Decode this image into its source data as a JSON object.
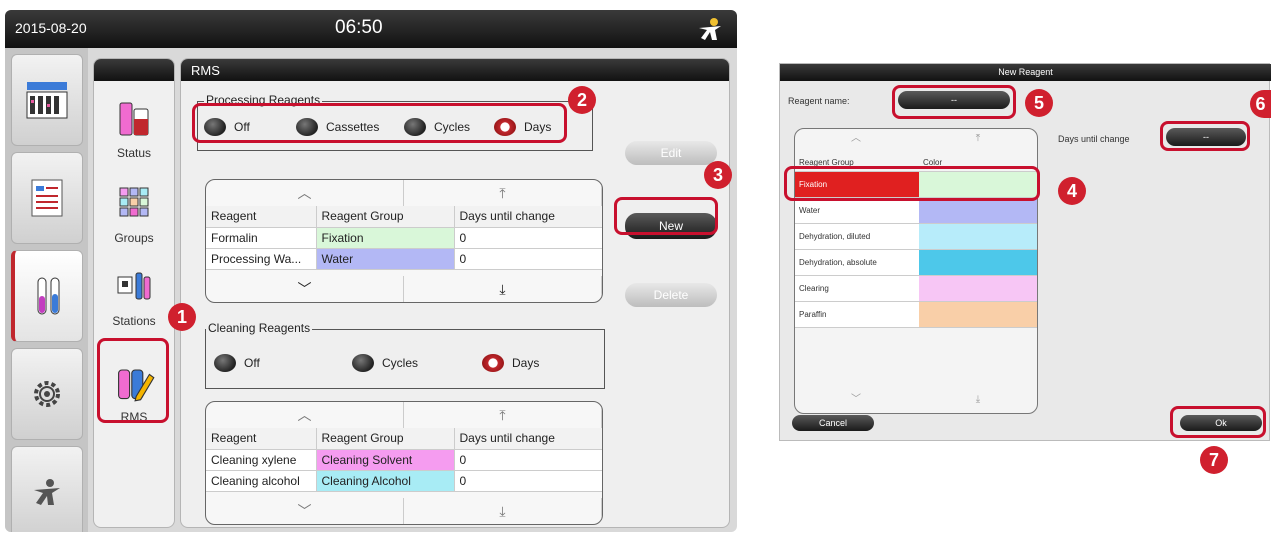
{
  "topbar": {
    "date": "2015-08-20",
    "time": "06:50"
  },
  "subnav": {
    "status": "Status",
    "groups": "Groups",
    "stations": "Stations",
    "rms": "RMS"
  },
  "rms": {
    "title": "RMS",
    "processing_legend": "Processing Reagents",
    "processing_options": [
      "Off",
      "Cassettes",
      "Cycles",
      "Days"
    ],
    "processing_selected": "Days",
    "cleaning_legend": "Cleaning Reagents",
    "cleaning_options": [
      "Off",
      "Cycles",
      "Days"
    ],
    "cleaning_selected": "Days",
    "table_headers": [
      "Reagent",
      "Reagent Group",
      "Days until change"
    ],
    "processing_rows": [
      {
        "reagent": "Formalin",
        "group": "Fixation",
        "color": "#d9f7d9",
        "days": "0"
      },
      {
        "reagent": "Processing Wa...",
        "group": "Water",
        "color": "#b3b8f5",
        "days": "0"
      }
    ],
    "cleaning_rows": [
      {
        "reagent": "Cleaning xylene",
        "group": "Cleaning Solvent",
        "color": "#f59cf0",
        "days": "0"
      },
      {
        "reagent": "Cleaning alcohol",
        "group": "Cleaning Alcohol",
        "color": "#a8ecf5",
        "days": "0"
      }
    ],
    "buttons": {
      "edit": "Edit",
      "new": "New",
      "delete": "Delete"
    }
  },
  "dialog": {
    "title": "New Reagent",
    "reagent_name_label": "Reagent name:",
    "reagent_name_value": "--",
    "days_label": "Days until change",
    "days_value": "--",
    "list_headers": [
      "Reagent Group",
      "Color"
    ],
    "groups": [
      {
        "name": "Fixation",
        "color": "#d9f7d9",
        "selected": true
      },
      {
        "name": "Water",
        "color": "#b3b8f5",
        "selected": false
      },
      {
        "name": "Dehydration, diluted",
        "color": "#b7ecfa",
        "selected": false
      },
      {
        "name": "Dehydration, absolute",
        "color": "#4dc8ea",
        "selected": false
      },
      {
        "name": "Clearing",
        "color": "#f7c6f5",
        "selected": false
      },
      {
        "name": "Paraffin",
        "color": "#f9cfa8",
        "selected": false
      }
    ],
    "cancel": "Cancel",
    "ok": "Ok"
  },
  "callouts": [
    "1",
    "2",
    "3",
    "4",
    "5",
    "6",
    "7"
  ],
  "colors": {
    "accent_red": "#c8102e",
    "selected_row": "#e02020"
  }
}
